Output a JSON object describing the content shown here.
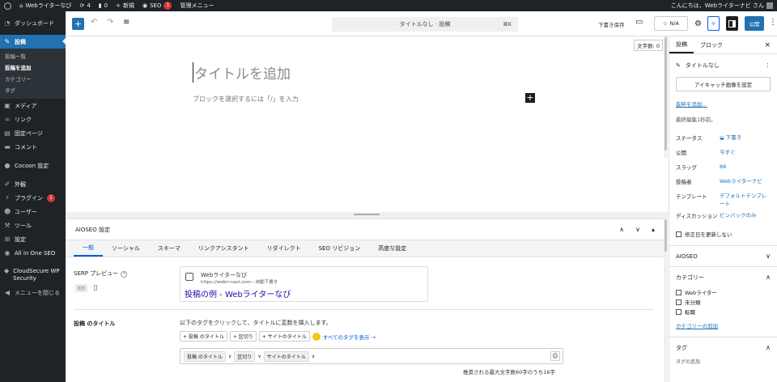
{
  "admin_bar": {
    "site_name": "Webライターなび",
    "updates_count": "4",
    "comments_count": "0",
    "new_label": "新規",
    "seo_label": "SEO",
    "seo_badge": "1",
    "admin_menu_label": "管理メニュー",
    "greeting": "こんにちは、Webライターナビ さん"
  },
  "sidebar": {
    "items": [
      {
        "label": "ダッシュボード",
        "icon": "dashboard-icon"
      },
      {
        "label": "投稿",
        "icon": "pin-icon"
      },
      {
        "label": "メディア",
        "icon": "media-icon"
      },
      {
        "label": "リンク",
        "icon": "link-icon"
      },
      {
        "label": "固定ページ",
        "icon": "page-icon"
      },
      {
        "label": "コメント",
        "icon": "comment-icon"
      },
      {
        "label": "Cocoon 設定",
        "icon": "cocoon-icon"
      },
      {
        "label": "外観",
        "icon": "brush-icon"
      },
      {
        "label": "プラグイン",
        "icon": "plugin-icon",
        "badge": "1"
      },
      {
        "label": "ユーザー",
        "icon": "user-icon"
      },
      {
        "label": "ツール",
        "icon": "wrench-icon"
      },
      {
        "label": "設定",
        "icon": "settings-icon"
      },
      {
        "label": "All in One SEO",
        "icon": "aioseo-icon"
      },
      {
        "label": "CloudSecure WP Security",
        "icon": "shield-icon"
      },
      {
        "label": "メニューを閉じる",
        "icon": "collapse-icon"
      }
    ],
    "submenu": [
      "投稿一覧",
      "投稿を追加",
      "カテゴリー",
      "タグ"
    ]
  },
  "toolbar": {
    "doc_title": "タイトルなし · 投稿",
    "shortcut": "⌘K",
    "save_draft": "下書き保存",
    "na_label": "N/A",
    "publish": "公開"
  },
  "editor": {
    "word_count": "文字数: 0",
    "title_placeholder": "タイトルを追加",
    "block_placeholder": "ブロックを選択するには「/」を入力"
  },
  "aioseo": {
    "heading": "AIOSEO 設定",
    "tabs": [
      "一般",
      "ソーシャル",
      "スキーマ",
      "リンクアシスタント",
      "リダイレクト",
      "SEO リビジョン",
      "高度な設定"
    ],
    "serp_label": "SERP プレビュー",
    "serp_site": "Webライターなび",
    "serp_url": "https://webri-navi.com › 自動下書き",
    "serp_title": "投稿の例 - Webライターなび",
    "post_title_label": "投稿 のタイトル",
    "tag_help": "以下のタグをクリックして、タイトルに変数を挿入します。",
    "tag_buttons": [
      "+ 投稿 のタイトル",
      "+ 区切り",
      "+ サイトのタイトル"
    ],
    "show_all_tags": "すべてのタグを表示 →",
    "title_chips": [
      "投稿 のタイトル",
      "区切り",
      "サイトのタイトル"
    ],
    "char_count": "推奨される最大文字数60字のうち16字"
  },
  "settings": {
    "tabs": [
      "投稿",
      "ブロック"
    ],
    "post_title": "タイトルなし",
    "featured_image": "アイキャッチ画像を設定",
    "add_excerpt": "抜粋を追加…",
    "last_edited": "最終編集1秒前。",
    "rows": [
      {
        "key": "ステータス",
        "value": "下書き"
      },
      {
        "key": "公開",
        "value": "今すぐ"
      },
      {
        "key": "スラッグ",
        "value": "88"
      },
      {
        "key": "投稿者",
        "value": "Webライターナビ"
      },
      {
        "key": "テンプレート",
        "value": "デフォルトテンプレート"
      },
      {
        "key": "ディスカッション",
        "value": "ピンバックのみ"
      }
    ],
    "no_update_date": "修正日を更新しない",
    "aioseo_panel": "AIOSEO",
    "category_panel": "カテゴリー",
    "categories": [
      "Webライター",
      "未分類",
      "転職"
    ],
    "add_category": "カテゴリーの追加",
    "tag_panel": "タグ",
    "add_tag": "タグの追加"
  },
  "colors": {
    "admin_bg": "#1d2327",
    "accent": "#2271b1",
    "aioseo_blue": "#005ae0",
    "badge_red": "#d63638"
  }
}
